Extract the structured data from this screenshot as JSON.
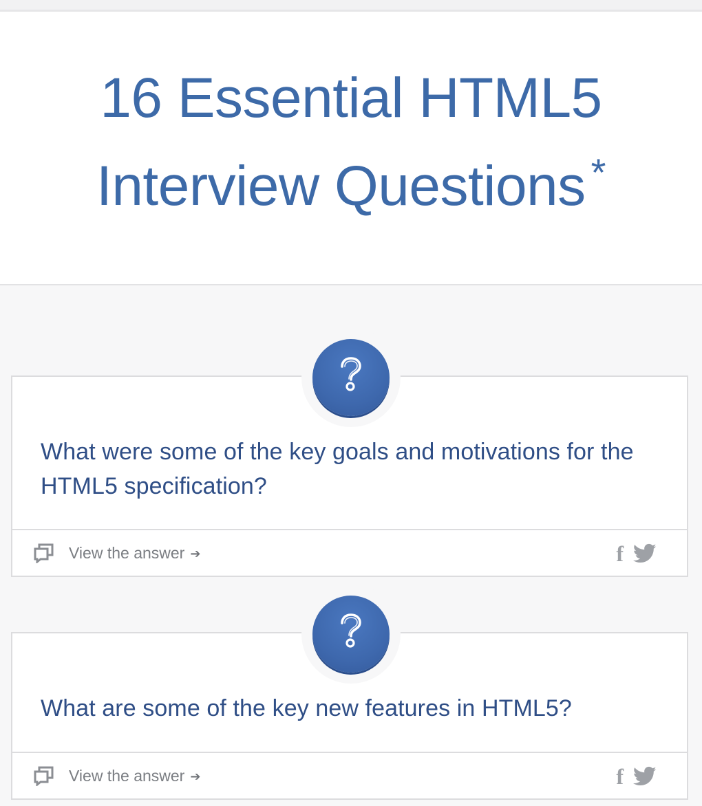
{
  "page": {
    "title_main": "16 Essential HTML5 Interview Questions",
    "title_mark": "*",
    "accent_color": "#3d6aa8",
    "question_color": "#2f4e86"
  },
  "questions": [
    {
      "text": "What were some of the key goals and motivations for the HTML5 specification?",
      "answer_link": "View the answer",
      "answer_arrow": "➔",
      "badge_icon": "question-mark-icon",
      "share": {
        "facebook": "f",
        "twitter": "twitter-bird-icon"
      }
    },
    {
      "text": "What are some of the key new features in HTML5?",
      "answer_link": "View the answer",
      "answer_arrow": "➔",
      "badge_icon": "question-mark-icon",
      "share": {
        "facebook": "f",
        "twitter": "twitter-bird-icon"
      }
    }
  ]
}
